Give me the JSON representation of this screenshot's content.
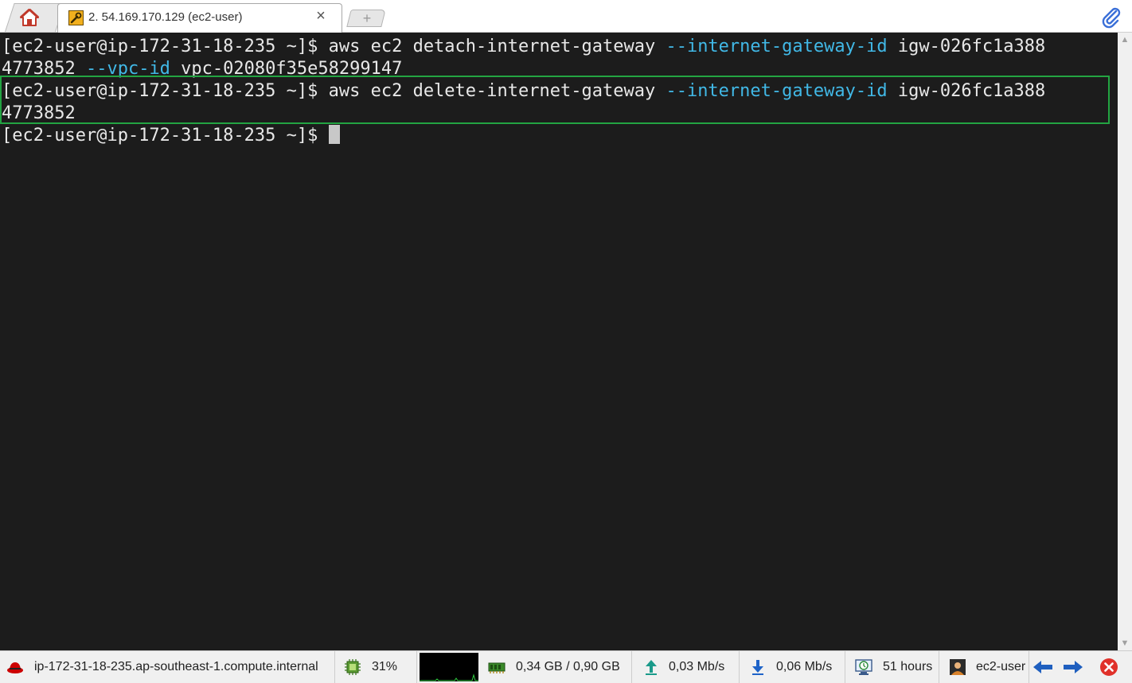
{
  "window": {
    "session_tab_title": "2. 54.169.170.129 (ec2-user)",
    "close_label": "×",
    "new_tab_label": "+"
  },
  "terminal": {
    "lines": [
      {
        "prompt": "[ec2-user@ip-172-31-18-235 ~]$ ",
        "cmd": "aws ec2 detach-internet-gateway ",
        "arg1": "--internet-gateway-id",
        "rest": " igw-026fc1a388"
      },
      {
        "cont": "4773852 ",
        "arg2": "--vpc-id",
        "rest": " vpc-02080f35e58299147"
      },
      {
        "prompt": "[ec2-user@ip-172-31-18-235 ~]$ ",
        "cmd": "aws ec2 delete-internet-gateway ",
        "arg1": "--internet-gateway-id",
        "rest": " igw-026fc1a388"
      },
      {
        "cont": "4773852"
      },
      {
        "prompt": "[ec2-user@ip-172-31-18-235 ~]$ "
      }
    ],
    "highlight_color": "#23a442",
    "arg_color": "#41b8e6",
    "background": "#1c1c1c"
  },
  "statusbar": {
    "hostname": "ip-172-31-18-235.ap-southeast-1.compute.internal",
    "cpu": "31%",
    "memory": "0,34 GB / 0,90 GB",
    "upload": "0,03 Mb/s",
    "download": "0,06 Mb/s",
    "uptime": "51 hours",
    "user": "ec2-user"
  }
}
